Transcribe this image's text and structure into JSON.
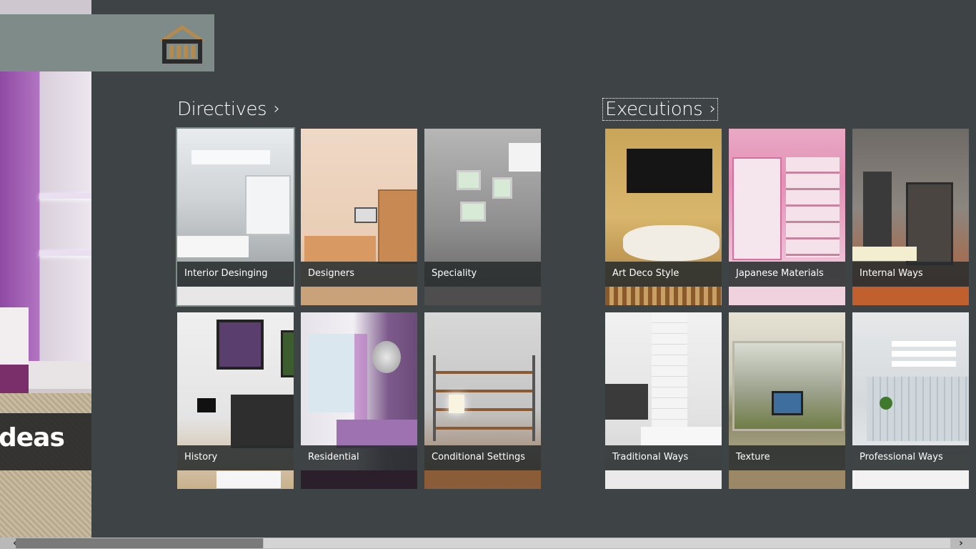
{
  "colors": {
    "background": "#3e4446",
    "logo_bar": "#7e8b89",
    "caption_bg": "#2c3032",
    "logo_gold": "#b48a4e",
    "logo_dark": "#2b2b2b"
  },
  "hero": {
    "caption": "deas"
  },
  "logo": {
    "icon": "house-icon"
  },
  "sections": [
    {
      "title": "Directives",
      "chevron": "›",
      "tiles": [
        {
          "label": "Interior Desinging"
        },
        {
          "label": "Designers"
        },
        {
          "label": "Speciality"
        },
        {
          "label": "History"
        },
        {
          "label": "Residential"
        },
        {
          "label": "Conditional Settings"
        }
      ]
    },
    {
      "title": "Executions",
      "chevron": "›",
      "tiles": [
        {
          "label": "Art Deco Style"
        },
        {
          "label": "Japanese Materials"
        },
        {
          "label": "Internal Ways"
        },
        {
          "label": "Traditional Ways"
        },
        {
          "label": "Texture"
        },
        {
          "label": "Professional Ways"
        }
      ]
    }
  ],
  "scrollbar": {
    "left_arrow": "‹",
    "right_arrow": "›"
  }
}
